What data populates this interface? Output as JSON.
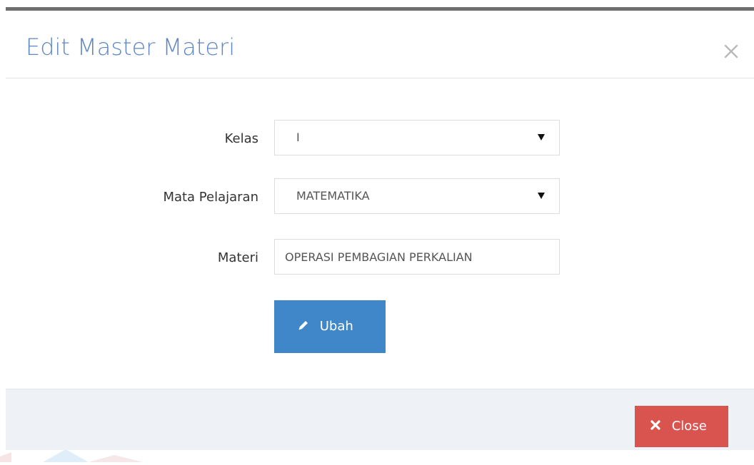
{
  "modal": {
    "title": "Edit Master Materi"
  },
  "form": {
    "kelas": {
      "label": "Kelas",
      "value": "I"
    },
    "mata_pelajaran": {
      "label": "Mata Pelajaran",
      "value": "MATEMATIKA"
    },
    "materi": {
      "label": "Materi",
      "value": "OPERASI PEMBAGIAN PERKALIAN"
    },
    "submit": {
      "label": "Ubah",
      "icon": "pencil-icon"
    }
  },
  "footer": {
    "close_label": "Close",
    "close_icon": "times-icon"
  },
  "colors": {
    "title": "#5f86c4",
    "primary_button": "#4087ca",
    "danger_button": "#d9534f",
    "footer_bg": "#eef1f5"
  }
}
